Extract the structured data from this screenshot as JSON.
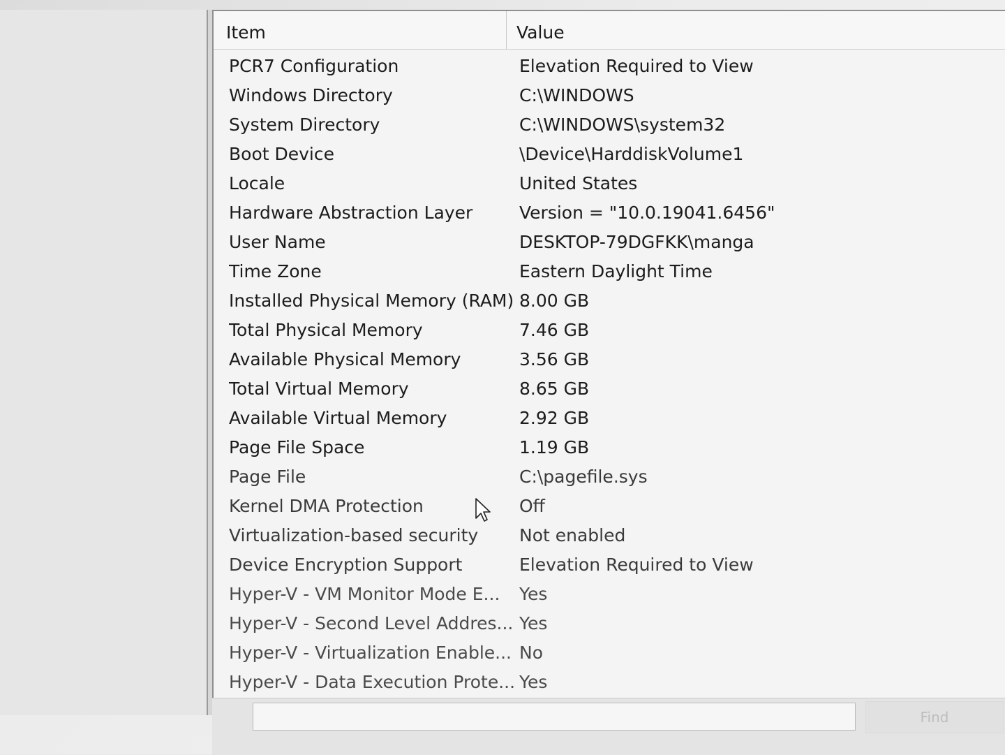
{
  "columns": {
    "item": "Item",
    "value": "Value"
  },
  "rows": [
    {
      "item": "PCR7 Configuration",
      "value": "Elevation Required to View"
    },
    {
      "item": "Windows Directory",
      "value": "C:\\WINDOWS"
    },
    {
      "item": "System Directory",
      "value": "C:\\WINDOWS\\system32"
    },
    {
      "item": "Boot Device",
      "value": "\\Device\\HarddiskVolume1"
    },
    {
      "item": "Locale",
      "value": "United States"
    },
    {
      "item": "Hardware Abstraction Layer",
      "value": "Version = \"10.0.19041.6456\""
    },
    {
      "item": "User Name",
      "value": "DESKTOP-79DGFKK\\manga"
    },
    {
      "item": "Time Zone",
      "value": "Eastern Daylight Time"
    },
    {
      "item": "Installed Physical Memory (RAM)",
      "value": "8.00 GB"
    },
    {
      "item": "Total Physical Memory",
      "value": "7.46 GB"
    },
    {
      "item": "Available Physical Memory",
      "value": "3.56 GB"
    },
    {
      "item": "Total Virtual Memory",
      "value": "8.65 GB"
    },
    {
      "item": "Available Virtual Memory",
      "value": "2.92 GB"
    },
    {
      "item": "Page File Space",
      "value": "1.19 GB"
    },
    {
      "item": "Page File",
      "value": "C:\\pagefile.sys"
    },
    {
      "item": "Kernel DMA Protection",
      "value": "Off"
    },
    {
      "item": "Virtualization-based security",
      "value": "Not enabled"
    },
    {
      "item": "Device Encryption Support",
      "value": "Elevation Required to View"
    },
    {
      "item": "Hyper-V - VM Monitor Mode E...",
      "value": "Yes"
    },
    {
      "item": "Hyper-V - Second Level Addres...",
      "value": "Yes"
    },
    {
      "item": "Hyper-V - Virtualization Enable...",
      "value": "No"
    },
    {
      "item": "Hyper-V - Data Execution Prote...",
      "value": "Yes"
    }
  ],
  "find": {
    "input_value": "",
    "button_label": "Find"
  },
  "icons": {
    "cursor": "mouse-pointer-icon"
  }
}
